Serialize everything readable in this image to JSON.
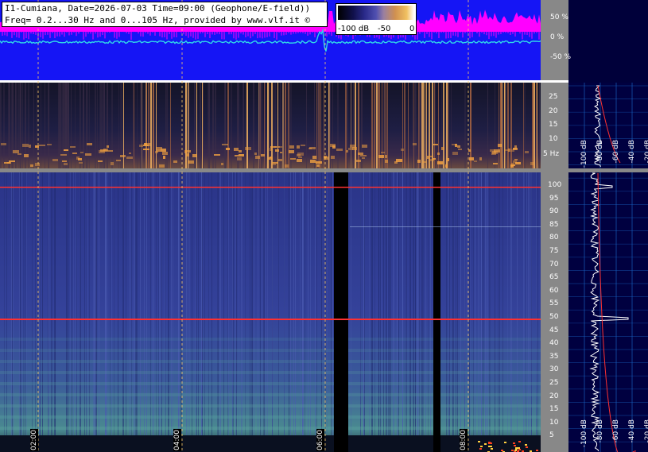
{
  "header": {
    "line1": "I1-Cumiana, Date=2026-07-03 Time=09:00 (Geophone/E-field))",
    "line2": "Freq= 0.2...30 Hz and 0...105 Hz, provided by www.vlf.it ©"
  },
  "colorbar": {
    "label_min": "-100 dB",
    "label_mid": "-50",
    "label_max": "0"
  },
  "top_axis_labels": [
    "50 %",
    "0 %",
    "-50 %"
  ],
  "mid_axis_labels": [
    "25",
    "20",
    "15",
    "10",
    "5 Hz"
  ],
  "bottom_axis_labels": [
    "100",
    "95",
    "90",
    "85",
    "80",
    "75",
    "70",
    "65",
    "60",
    "55",
    "50",
    "45",
    "40",
    "35",
    "30",
    "25",
    "20",
    "15",
    "10",
    "5"
  ],
  "time_labels": [
    "02:00",
    "04:00",
    "06:00",
    "08:00"
  ],
  "side_labels_mid": [
    "-100 dB",
    "-80 dB",
    "-60 dB",
    "-40 dB",
    "-20 dB"
  ],
  "side_labels_bottom": [
    "-100 dB",
    "-80 dB",
    "-60 dB",
    "-40 dB",
    "-20 dB"
  ],
  "colors": {
    "top_background": "#1515f5",
    "magenta_trace": "#ff00ff",
    "cyan_trace": "#30d8e8",
    "mid_spectrogram_base": "#1a1a38",
    "bottom_spectrogram_base": "#2c3a8c",
    "grid_axis_bg": "#888888",
    "side_panel_bg": "#000040",
    "hum_line": "#ff3030",
    "time_marker": "#ffcc66"
  }
}
